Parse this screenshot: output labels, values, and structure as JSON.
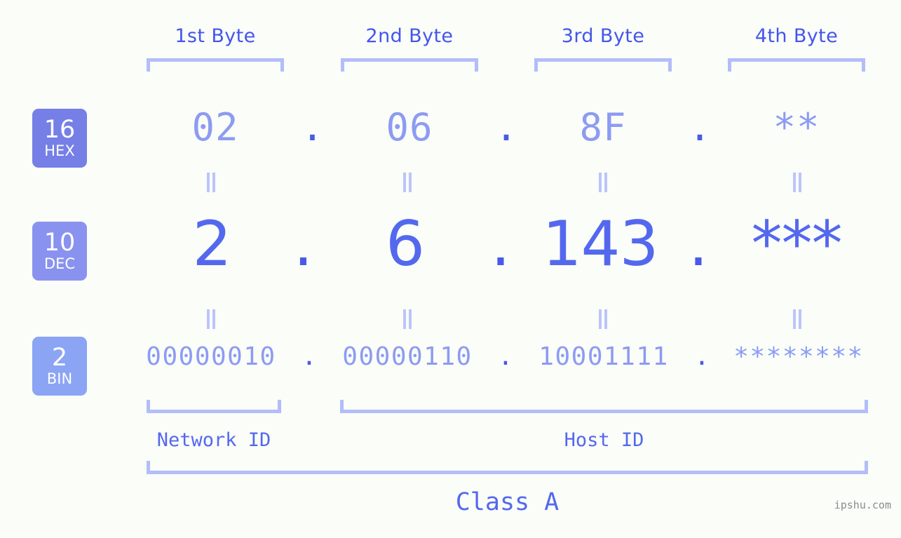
{
  "background_color": "#fafdf8",
  "accent_colors": {
    "header_blue": "#4455ee",
    "bracket_lavender": "#b3bdfa",
    "value_light": "#8d9bf2",
    "value_strong": "#5468ee",
    "dot_blue": "#4a5ae8",
    "badge_hex": "#757fe6",
    "badge_dec": "#8a92ef",
    "badge_bin": "#8ca4f4",
    "watermark_gray": "#8c8c8c"
  },
  "byte_headers": [
    {
      "label": "1st Byte"
    },
    {
      "label": "2nd Byte"
    },
    {
      "label": "3rd Byte"
    },
    {
      "label": "4th Byte"
    }
  ],
  "bases": [
    {
      "number": "16",
      "name": "HEX"
    },
    {
      "number": "10",
      "name": "DEC"
    },
    {
      "number": "2",
      "name": "BIN"
    }
  ],
  "rows": {
    "hex": {
      "base_number": "16",
      "base_name": "HEX",
      "octets": [
        "02",
        "06",
        "8F",
        "**"
      ],
      "separators": [
        ".",
        ".",
        "."
      ]
    },
    "dec": {
      "base_number": "10",
      "base_name": "DEC",
      "octets": [
        "2",
        "6",
        "143",
        "***"
      ],
      "separators": [
        ".",
        ".",
        "."
      ]
    },
    "bin": {
      "base_number": "2",
      "base_name": "BIN",
      "octets": [
        "00000010",
        "00000110",
        "10001111",
        "********"
      ],
      "separators": [
        ".",
        ".",
        "."
      ]
    }
  },
  "equal_marks": {
    "symbol": "=",
    "count_per_row": 4,
    "rows": 2
  },
  "segments": [
    {
      "label": "Network ID"
    },
    {
      "label": "Host ID"
    }
  ],
  "class_label": "Class A",
  "watermark": "ipshu.com"
}
